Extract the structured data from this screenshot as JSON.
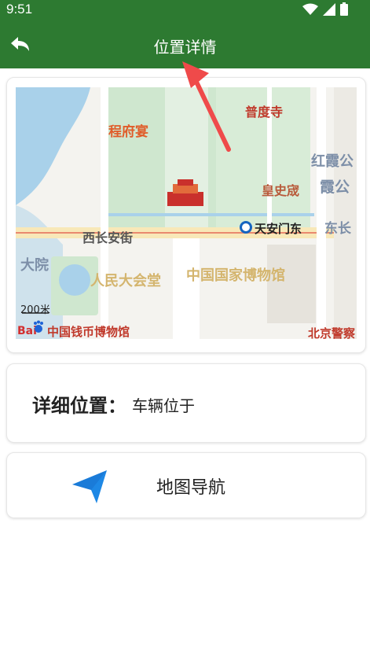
{
  "status_bar": {
    "time": "9:51"
  },
  "header": {
    "title": "位置详情"
  },
  "map": {
    "labels": {
      "pudu_temple": "普度寺",
      "chengfu_yan": "程府宴",
      "hongxia": "红霞公",
      "xia_gong": "霞公",
      "huang_shi_cheng": "皇史宬",
      "xi_chang_an_jie": "西长安街",
      "tiananmen_dong": "天安门东",
      "dong_chang": "东长",
      "da_yuan": "大院",
      "people_hall": "人民大会堂",
      "national_museum": "中国国家博物馆",
      "scale": "200米",
      "coin_museum": "中国钱币博物馆",
      "police_museum": "北京警察",
      "logo": "Bai"
    }
  },
  "location": {
    "label": "详细位置：",
    "value": "车辆位于"
  },
  "navigation": {
    "label": "地图导航"
  },
  "colors": {
    "header_bg": "#2d7a31",
    "nav_icon": "#1e88e5",
    "pointer_arrow": "#ef4a4a"
  }
}
